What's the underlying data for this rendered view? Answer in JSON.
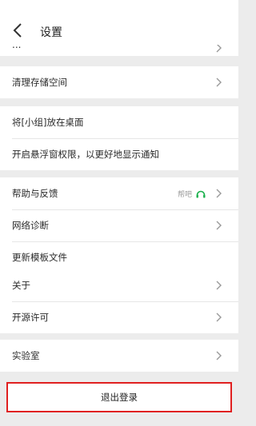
{
  "header": {
    "title": "设置"
  },
  "peek": {
    "label": "..."
  },
  "groups": [
    {
      "items": [
        {
          "label": "清理存储空间"
        }
      ]
    },
    {
      "items": [
        {
          "label": "将[小组]放在桌面"
        },
        {
          "label": "开启悬浮窗权限，以更好地显示通知"
        }
      ]
    },
    {
      "items": [
        {
          "label": "帮助与反馈",
          "extra": "帮吧"
        },
        {
          "label": "网络诊断"
        },
        {
          "label": "更新模板文件"
        }
      ]
    },
    {
      "items": [
        {
          "label": "关于"
        },
        {
          "label": "开源许可"
        }
      ]
    },
    {
      "items": [
        {
          "label": "实验室"
        }
      ]
    }
  ],
  "logout": {
    "label": "退出登录"
  },
  "colors": {
    "highlight": "#e02020",
    "headset": "#1ab04c"
  }
}
